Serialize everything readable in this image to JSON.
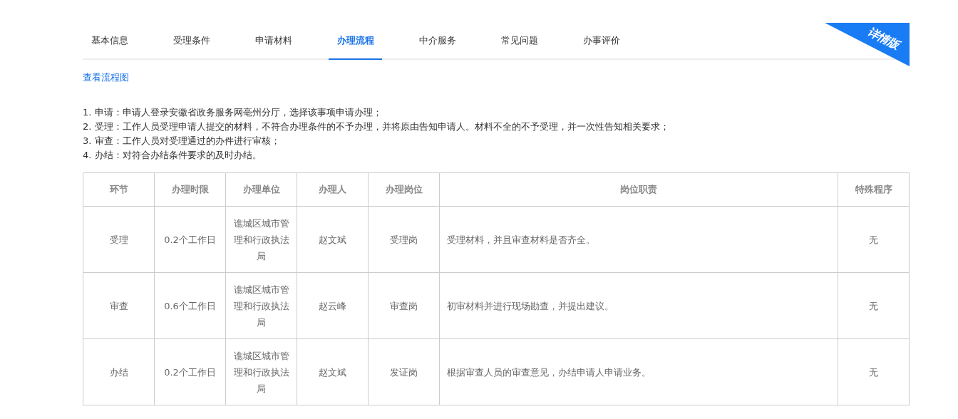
{
  "tabs": [
    {
      "label": "基本信息",
      "selected": false
    },
    {
      "label": "受理条件",
      "selected": false
    },
    {
      "label": "申请材料",
      "selected": false
    },
    {
      "label": "办理流程",
      "selected": true
    },
    {
      "label": "中介服务",
      "selected": false
    },
    {
      "label": "常见问题",
      "selected": false
    },
    {
      "label": "办事评价",
      "selected": false
    }
  ],
  "ribbon": {
    "label": "详情版"
  },
  "flowchart_link": "查看流程图",
  "steps": [
    "1. 申请：申请人登录安徽省政务服务网亳州分厅，选择该事项申请办理；",
    "2. 受理：工作人员受理申请人提交的材料，不符合办理条件的不予办理，并将原由告知申请人。材料不全的不予受理，并一次性告知相关要求；",
    "3. 审查：工作人员对受理通过的办件进行审核；",
    "4. 办结：对符合办结条件要求的及时办结。"
  ],
  "table": {
    "columns": [
      "环节",
      "办理时限",
      "办理单位",
      "办理人",
      "办理岗位",
      "岗位职责",
      "特殊程序"
    ],
    "rows": [
      [
        "受理",
        "0.2个工作日",
        "谯城区城市管理和行政执法局",
        "赵文斌",
        "受理岗",
        "受理材料，并且审查材料是否齐全。",
        "无"
      ],
      [
        "审查",
        "0.6个工作日",
        "谯城区城市管理和行政执法局",
        "赵云峰",
        "审查岗",
        "初审材料并进行现场勘查，并提出建议。",
        "无"
      ],
      [
        "办结",
        "0.2个工作日",
        "谯城区城市管理和行政执法局",
        "赵文斌",
        "发证岗",
        "根据审查人员的审查意见，办结申请人申请业务。",
        "无"
      ]
    ]
  }
}
